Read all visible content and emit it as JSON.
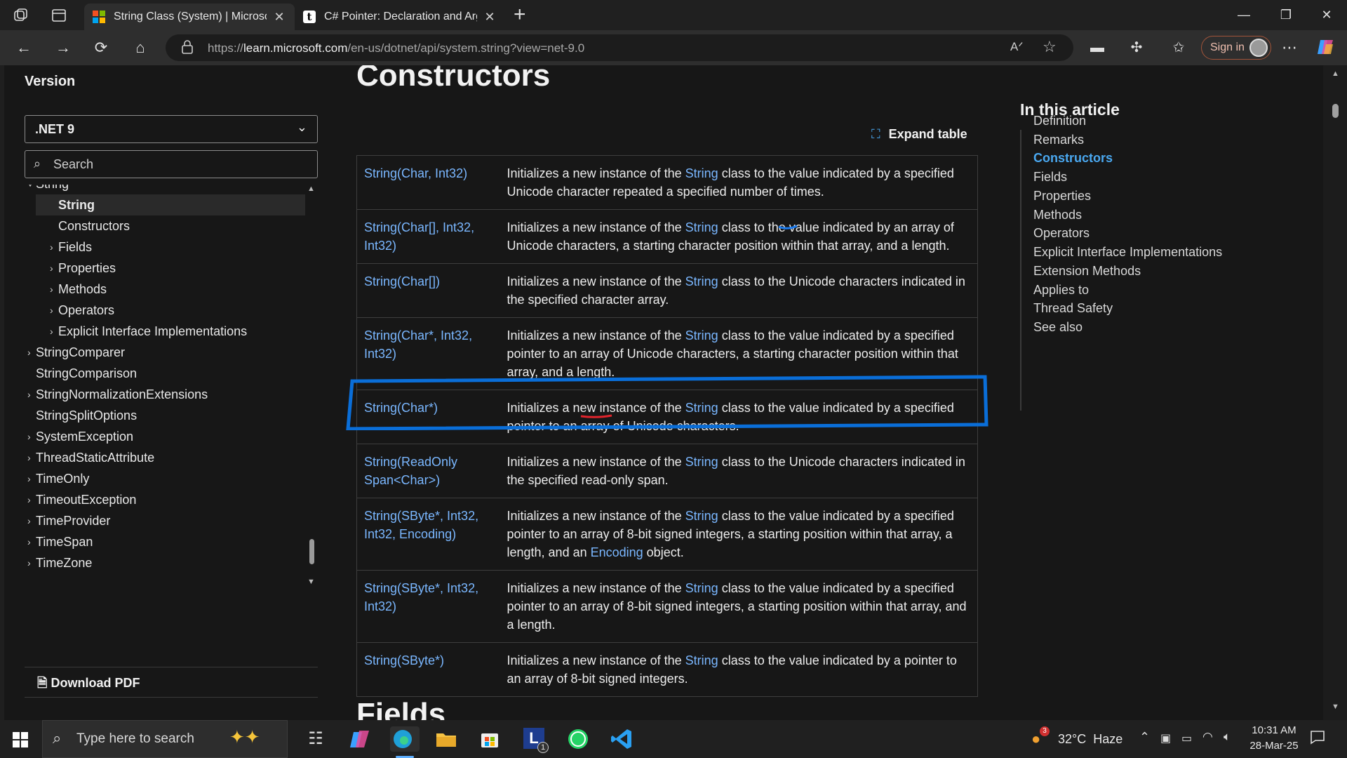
{
  "browser": {
    "tabs": [
      {
        "title": "String Class (System) | Microsoft L",
        "active": true
      },
      {
        "title": "C# Pointer: Declaration and Argun",
        "active": false
      }
    ],
    "new_tab": "+",
    "url_prefix": "https://",
    "url_host": "learn.microsoft.com",
    "url_path": "/en-us/dotnet/api/system.string?view=net-9.0",
    "sign_in": "Sign in"
  },
  "sidebar": {
    "version_label": "Version",
    "version_value": ".NET 9",
    "search_placeholder": "Search",
    "toc": [
      {
        "label": "String",
        "level": 0,
        "arrow": "˅",
        "partial": true
      },
      {
        "label": "String",
        "level": 1,
        "arrow": "",
        "selected": true
      },
      {
        "label": "Constructors",
        "level": 1,
        "arrow": ""
      },
      {
        "label": "Fields",
        "level": 1,
        "arrow": "›"
      },
      {
        "label": "Properties",
        "level": 1,
        "arrow": "›"
      },
      {
        "label": "Methods",
        "level": 1,
        "arrow": "›"
      },
      {
        "label": "Operators",
        "level": 1,
        "arrow": "›"
      },
      {
        "label": "Explicit Interface Implementations",
        "level": 1,
        "arrow": "›"
      },
      {
        "label": "StringComparer",
        "level": 0,
        "arrow": "›"
      },
      {
        "label": "StringComparison",
        "level": 0,
        "arrow": ""
      },
      {
        "label": "StringNormalizationExtensions",
        "level": 0,
        "arrow": "›"
      },
      {
        "label": "StringSplitOptions",
        "level": 0,
        "arrow": ""
      },
      {
        "label": "SystemException",
        "level": 0,
        "arrow": "›"
      },
      {
        "label": "ThreadStaticAttribute",
        "level": 0,
        "arrow": "›"
      },
      {
        "label": "TimeOnly",
        "level": 0,
        "arrow": "›"
      },
      {
        "label": "TimeoutException",
        "level": 0,
        "arrow": "›"
      },
      {
        "label": "TimeProvider",
        "level": 0,
        "arrow": "›"
      },
      {
        "label": "TimeSpan",
        "level": 0,
        "arrow": "›"
      },
      {
        "label": "TimeZone",
        "level": 0,
        "arrow": "›"
      }
    ],
    "download_pdf": "Download PDF"
  },
  "main": {
    "heading": "Constructors",
    "expand_table": "Expand table",
    "constructors": [
      {
        "signature": "String(Char, Int32)",
        "pre": "Initializes a new instance of the ",
        "link": "String",
        "post": " class to the value indicated by a specified Unicode character repeated a specified number of times."
      },
      {
        "signature": "String(Char[], Int32, Int32)",
        "pre": "Initializes a new instance of the ",
        "link": "String",
        "post": " class to the value indicated by an array of Unicode characters, a starting character position within that array, and a length."
      },
      {
        "signature": "String(Char[])",
        "pre": "Initializes a new instance of the ",
        "link": "String",
        "post": " class to the Unicode characters indicated in the specified character array."
      },
      {
        "signature": "String(Char*, Int32, Int32)",
        "pre": "Initializes a new instance of the ",
        "link": "String",
        "post": " class to the value indicated by a specified pointer to an array of Unicode characters, a starting character position within that array, and a length."
      },
      {
        "signature": "String(Char*)",
        "pre": "Initializes a new instance of the ",
        "link": "String",
        "post": " class to the value indicated by a specified pointer to an array of Unicode characters."
      },
      {
        "signature": "String(ReadOnly Span<Char>)",
        "pre": "Initializes a new instance of the ",
        "link": "String",
        "post": " class to the Unicode characters indicated in the specified read-only span."
      },
      {
        "signature": "String(SByte*, Int32, Int32, Encoding)",
        "pre": "Initializes a new instance of the ",
        "link": "String",
        "post": " class to the value indicated by a specified pointer to an array of 8-bit signed integers, a starting position within that array, a length, and an ",
        "link2": "Encoding",
        "post2": " object."
      },
      {
        "signature": "String(SByte*, Int32, Int32)",
        "pre": "Initializes a new instance of the ",
        "link": "String",
        "post": " class to the value indicated by a specified pointer to an array of 8-bit signed integers, a starting position within that array, and a length."
      },
      {
        "signature": "String(SByte*)",
        "pre": "Initializes a new instance of the ",
        "link": "String",
        "post": " class to the value indicated by a pointer to an array of 8-bit signed integers."
      }
    ],
    "next_heading": "Fields"
  },
  "in_this_article": {
    "title": "In this article",
    "items": [
      "Definition",
      "Remarks",
      "Constructors",
      "Fields",
      "Properties",
      "Methods",
      "Operators",
      "Explicit Interface Implementations",
      "Extension Methods",
      "Applies to",
      "Thread Safety",
      "See also"
    ],
    "active": "Constructors"
  },
  "taskbar": {
    "search_placeholder": "Type here to search",
    "weather": "32°C  Haze",
    "weather_badge": "3",
    "time": "10:31 AM",
    "date": "28-Mar-25",
    "app_badge": "1"
  },
  "colors": {
    "link": "#7ab7ff",
    "accent": "#4aa8f0",
    "annotation_box": "#0a6ed8",
    "annotation_underline_red": "#e0242c"
  }
}
